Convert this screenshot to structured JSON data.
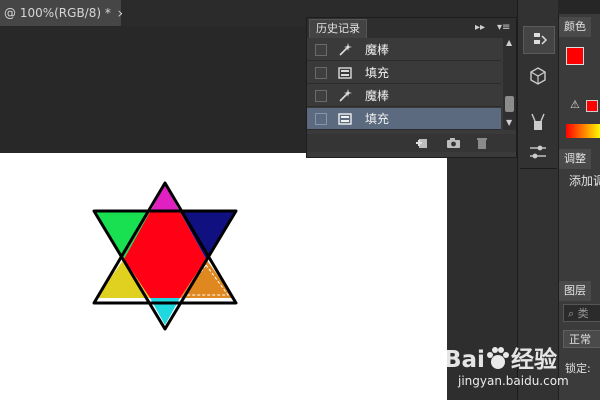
{
  "document": {
    "tab_title": "@ 100%(RGB/8) *",
    "close_glyph": "×"
  },
  "history_panel": {
    "tab_label": "历史记录",
    "items": [
      {
        "label": "魔棒",
        "icon": "magic-wand-icon",
        "selected": false
      },
      {
        "label": "填充",
        "icon": "fill-layer-icon",
        "selected": false
      },
      {
        "label": "魔棒",
        "icon": "magic-wand-icon",
        "selected": false
      },
      {
        "label": "填充",
        "icon": "fill-layer-icon",
        "selected": true
      }
    ],
    "footer_icons": [
      "new-document-from-state-icon",
      "camera-snapshot-icon",
      "trash-icon"
    ]
  },
  "right_panels": {
    "color_tab": "颜色",
    "adjust_tab": "调整",
    "adjust_text": "添加调",
    "layers_tab": "图层",
    "search_placeholder": "类",
    "blend_mode": "正常",
    "lock_label": "锁定:"
  },
  "colors": {
    "foreground": "#ff0000",
    "background": "#ffffff",
    "selected_row": "#5b6a7e",
    "star_center": "#ff0015",
    "star_top": "#e020c0",
    "star_top_right": "#101080",
    "star_top_left": "#19e050",
    "star_bottom_left": "#e0d020",
    "star_bottom": "#20d8e0",
    "star_bottom_right": "#e08820"
  },
  "watermark": {
    "brand": "Bai",
    "suffix": "经验",
    "url": "jingyan.baidu.com"
  }
}
